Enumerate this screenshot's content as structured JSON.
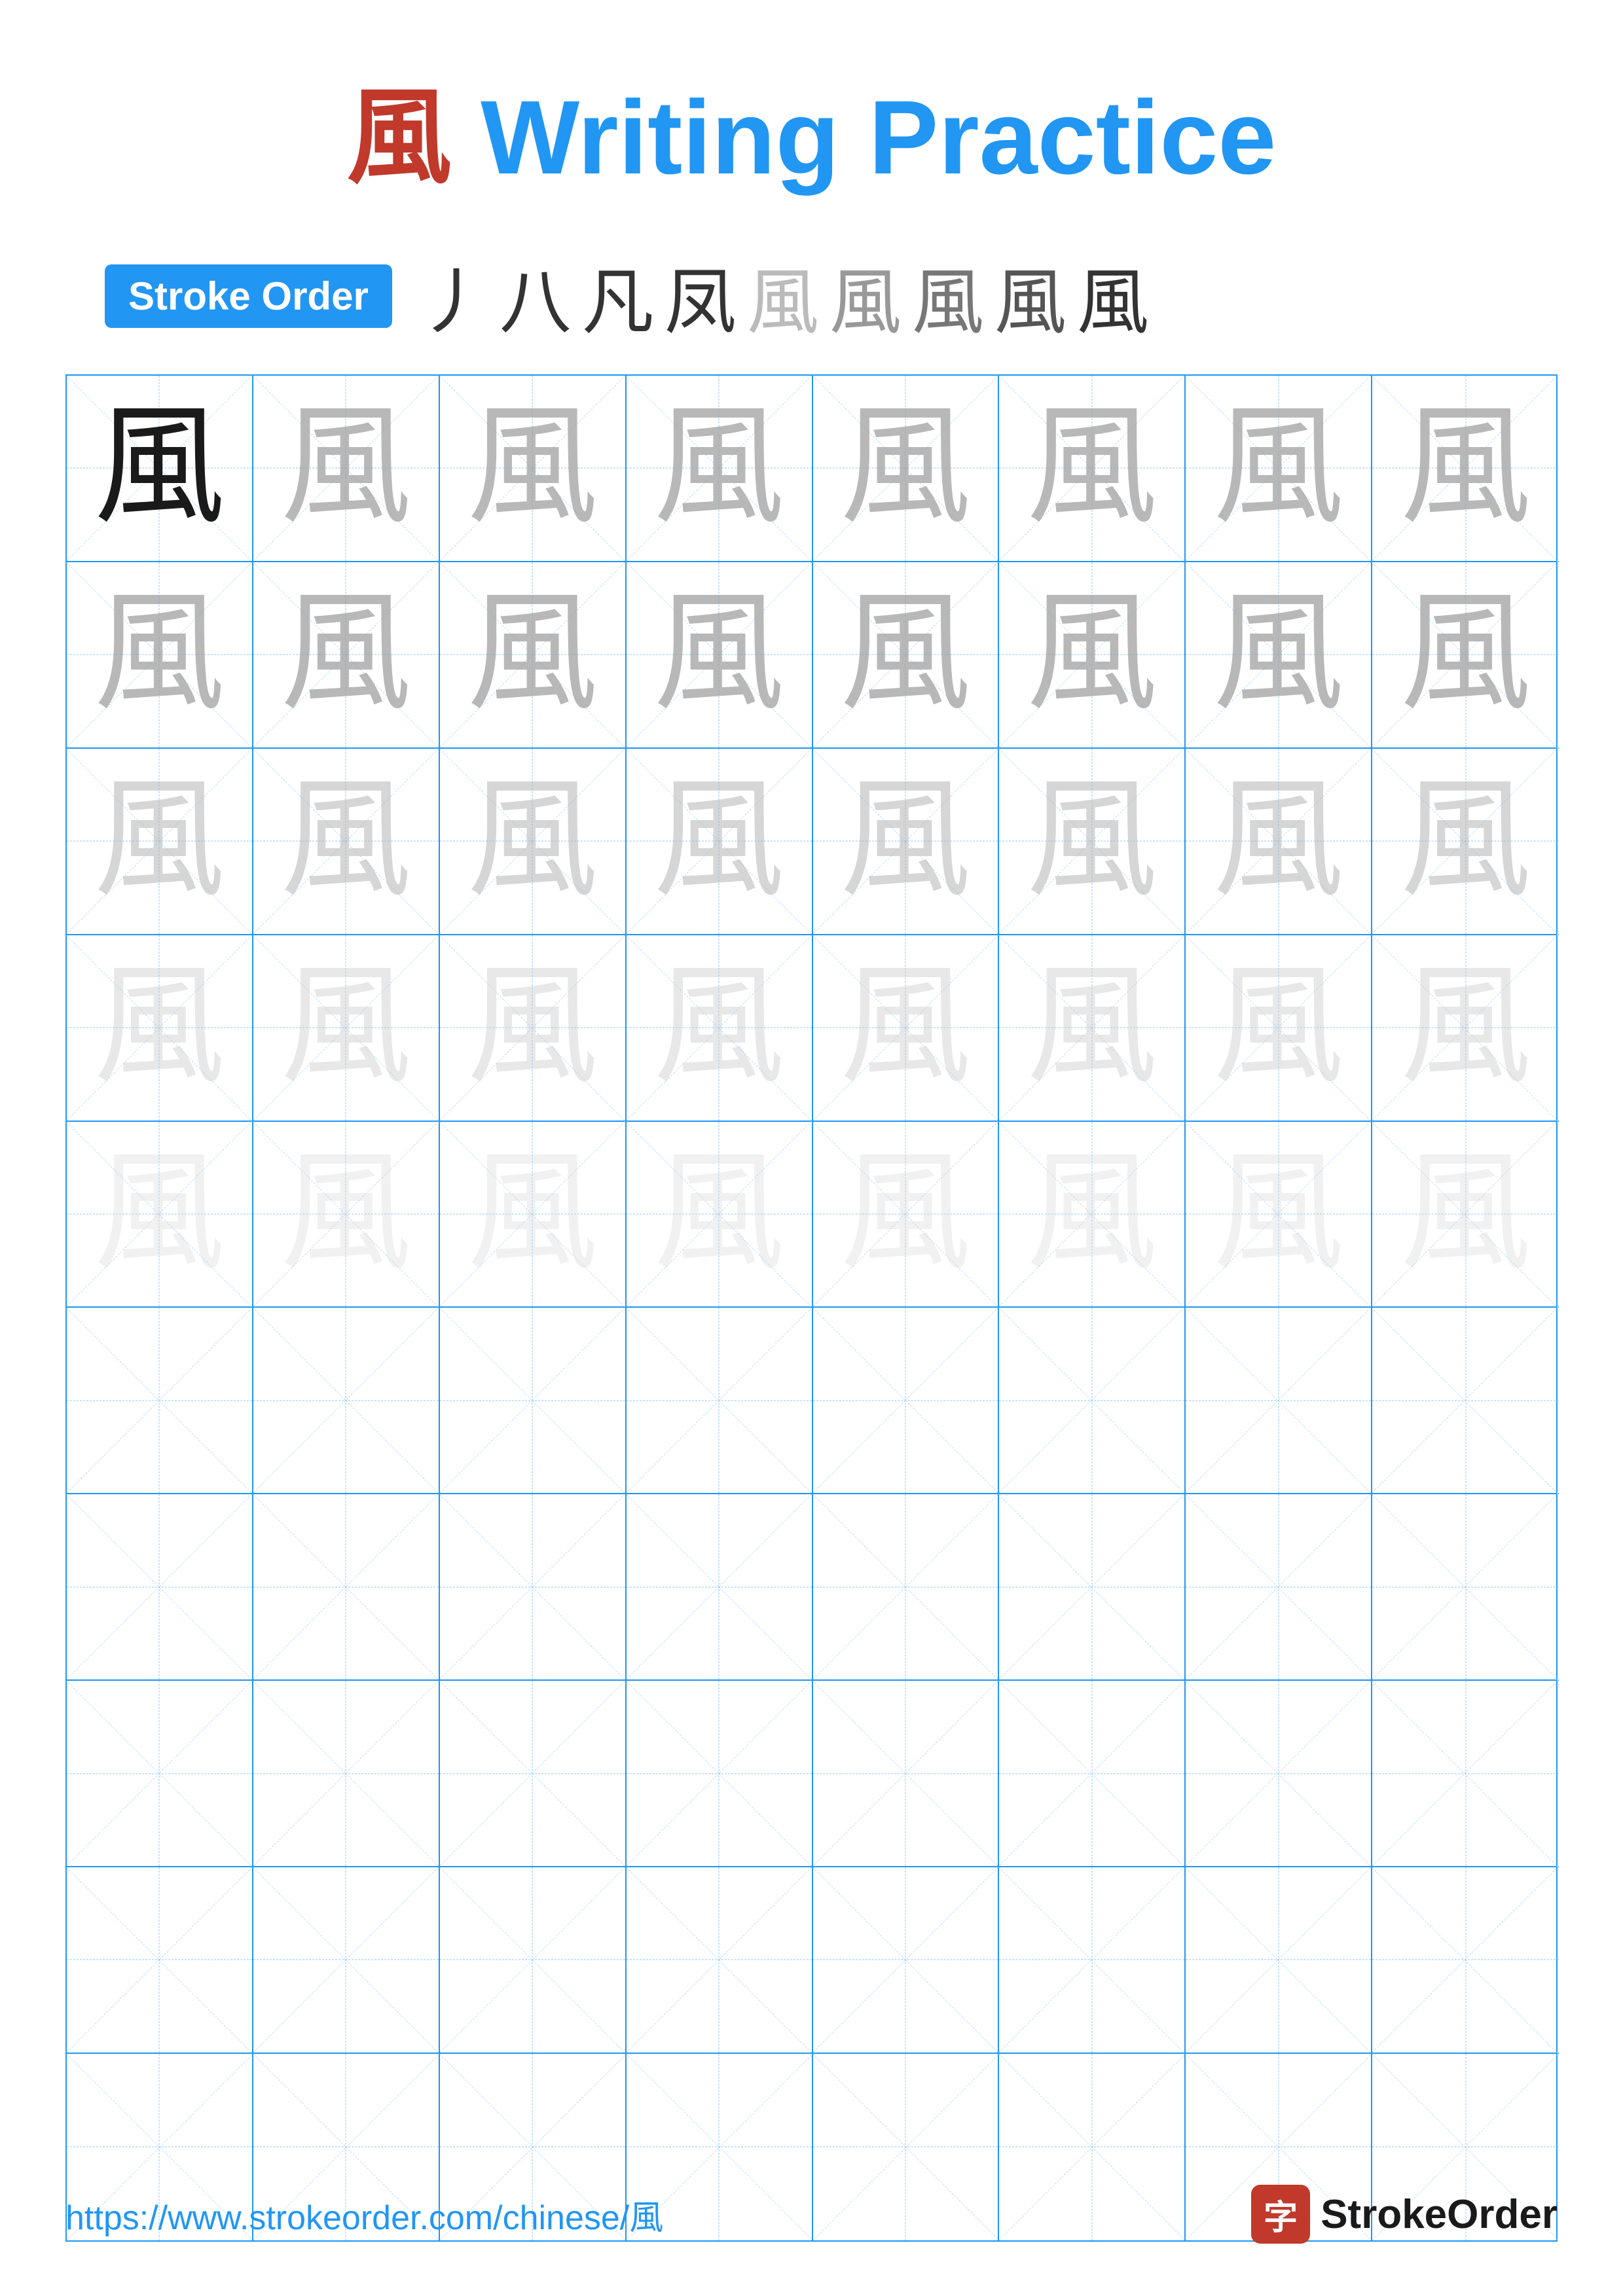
{
  "title": {
    "kanji": "風",
    "text": "Writing Practice"
  },
  "stroke_order": {
    "badge_label": "Stroke Order",
    "sequence": [
      "丿",
      "八",
      "凡",
      "凤",
      "凨",
      "風",
      "風",
      "風",
      "風"
    ]
  },
  "grid": {
    "rows": 10,
    "cols": 8,
    "kanji": "風",
    "filled_rows": 5,
    "row_opacities": [
      "dark",
      "light1",
      "light2",
      "light3",
      "light4"
    ]
  },
  "footer": {
    "url": "https://www.strokeorder.com/chinese/風",
    "logo_char": "字",
    "logo_text": "StrokeOrder"
  }
}
